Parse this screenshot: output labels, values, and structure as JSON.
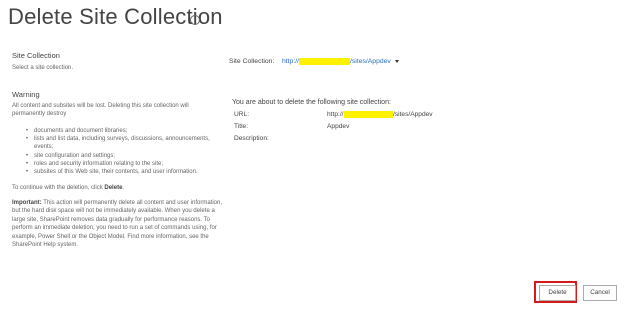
{
  "page": {
    "title": "Delete Site Collection",
    "info_icon": "i"
  },
  "site_collection_section": {
    "heading": "Site Collection",
    "description": "Select a site collection.",
    "selector_label": "Site Collection:",
    "selector_value_prefix": "http://",
    "selector_value_redacted": "xxxxxxxxxx:8888",
    "selector_value_suffix": "/sites/Appdev",
    "caret_icon": "chevron-down-icon"
  },
  "warning_section": {
    "heading": "Warning",
    "intro": "All content and subsites will be lost. Deleting this site collection will permanently destroy",
    "items": [
      "documents and document libraries;",
      "lists and list data, including surveys, discussions, announcements, events;",
      "site configuration and settings;",
      "roles and security information relating to the site;",
      "subsites of this Web site, their contents, and user information."
    ],
    "continue_prefix": "To continue with the deletion, click ",
    "continue_bold": "Delete",
    "continue_suffix": ".",
    "important_label": "Important:",
    "important_text": "  This action will permanently delete all content and user information, but the hard disk space will not be immediately available. When you delete a large site, SharePoint removes data gradually for performance reasons. To perform an immediate deletion, you need to run a set of commands using, for example, Power Shell or the Object Model. Find more information, see the SharePoint Help system."
  },
  "details": {
    "about_text": "You are about to delete the following site collection:",
    "url_label": "URL:",
    "url_prefix": "http://",
    "url_redacted": "xxxxxxxxxx:8888",
    "url_suffix": "/sites/Appdev",
    "title_label": "Title:",
    "title_value": "Appdev",
    "description_label": "Description:",
    "description_value": ""
  },
  "buttons": {
    "delete_label": "Delete",
    "cancel_label": "Cancel"
  },
  "colors": {
    "link": "#2a6ebb",
    "redaction": "#fff200",
    "highlight_border": "#d7191c"
  }
}
